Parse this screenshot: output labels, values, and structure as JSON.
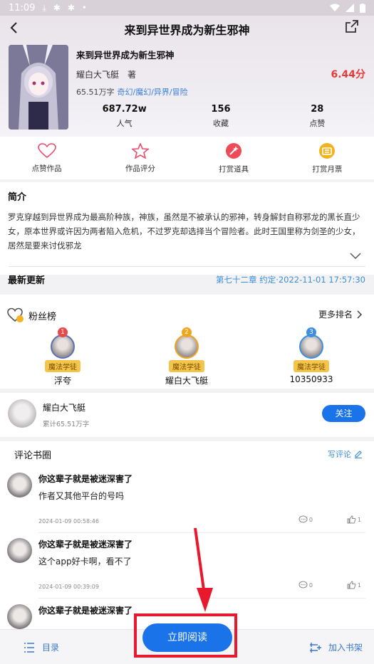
{
  "status_bar": {
    "time": "11:09",
    "icons": [
      "download-icon",
      "bug-icon",
      "bug-icon",
      "dot-icon",
      "wifi-icon",
      "signal-icon",
      "battery-icon"
    ]
  },
  "nav": {
    "title": "来到异世界成为新生邪神"
  },
  "book": {
    "title": "来到异世界成为新生邪神",
    "author": "耀白大飞艇　著",
    "score": "6.44分",
    "word_count": "65.51万字",
    "tags": "奇幻/魔幻/异界/冒险",
    "stats": [
      {
        "value": "687.72w",
        "label": "人气"
      },
      {
        "value": "156",
        "label": "收藏"
      },
      {
        "value": "28",
        "label": "点赞"
      }
    ]
  },
  "actions": [
    {
      "label": "点赞作品",
      "icon": "heart-icon"
    },
    {
      "label": "作品评分",
      "icon": "star-icon"
    },
    {
      "label": "打赏道具",
      "icon": "wand-icon"
    },
    {
      "label": "打赏月票",
      "icon": "ticket-icon"
    }
  ],
  "intro": {
    "title": "简介",
    "text": "罗克穿越到异世界成为最高阶种族，神族，虽然是不被承认的邪神，转身解封自称邪龙的黑长直少女，原本世界或许因为两者陷入危机，不过罗克却选择当个冒险者。此时王国里称为剑圣的少女，居然是要来讨伐邪龙"
  },
  "latest": {
    "title": "最新更新",
    "chapter": "第七十二章 约定·2022-11-01 17:57:30"
  },
  "fans": {
    "title": "粉丝榜",
    "more": "更多排名",
    "list": [
      {
        "rank": "1",
        "badge": "魔法学徒",
        "name": "浮夸",
        "color": "#e84a4a"
      },
      {
        "rank": "2",
        "badge": "魔法学徒",
        "name": "耀白大飞艇",
        "color": "#f0a61c"
      },
      {
        "rank": "3",
        "badge": "魔法学徒",
        "name": "10350933",
        "color": "#3f8fe0"
      }
    ]
  },
  "author_card": {
    "name": "耀白大飞艇",
    "total": "累计65.51万字",
    "follow": "关注"
  },
  "comments": {
    "title": "评论书圈",
    "write": "写评论",
    "list": [
      {
        "user": "你这辈子就是被迷深害了",
        "text": "作者又其他平台的号吗",
        "time": "2024-01-09 00:58:46",
        "replies": "0",
        "likes": "1"
      },
      {
        "user": "你这辈子就是被迷深害了",
        "text": "这个app好卡啊，看不了",
        "time": "2024-01-09 00:39:09",
        "replies": "0",
        "likes": "1"
      },
      {
        "user": "你这辈子就是被迷深害了",
        "text": "",
        "time": "",
        "replies": "",
        "likes": ""
      }
    ]
  },
  "bottom": {
    "toc": "目录",
    "read": "立即阅读",
    "shelf": "加入书架"
  },
  "colors": {
    "accent": "#1a73e8",
    "score": "#e63a3a",
    "link": "#3b8fd9",
    "annotation": "#e8192c"
  }
}
